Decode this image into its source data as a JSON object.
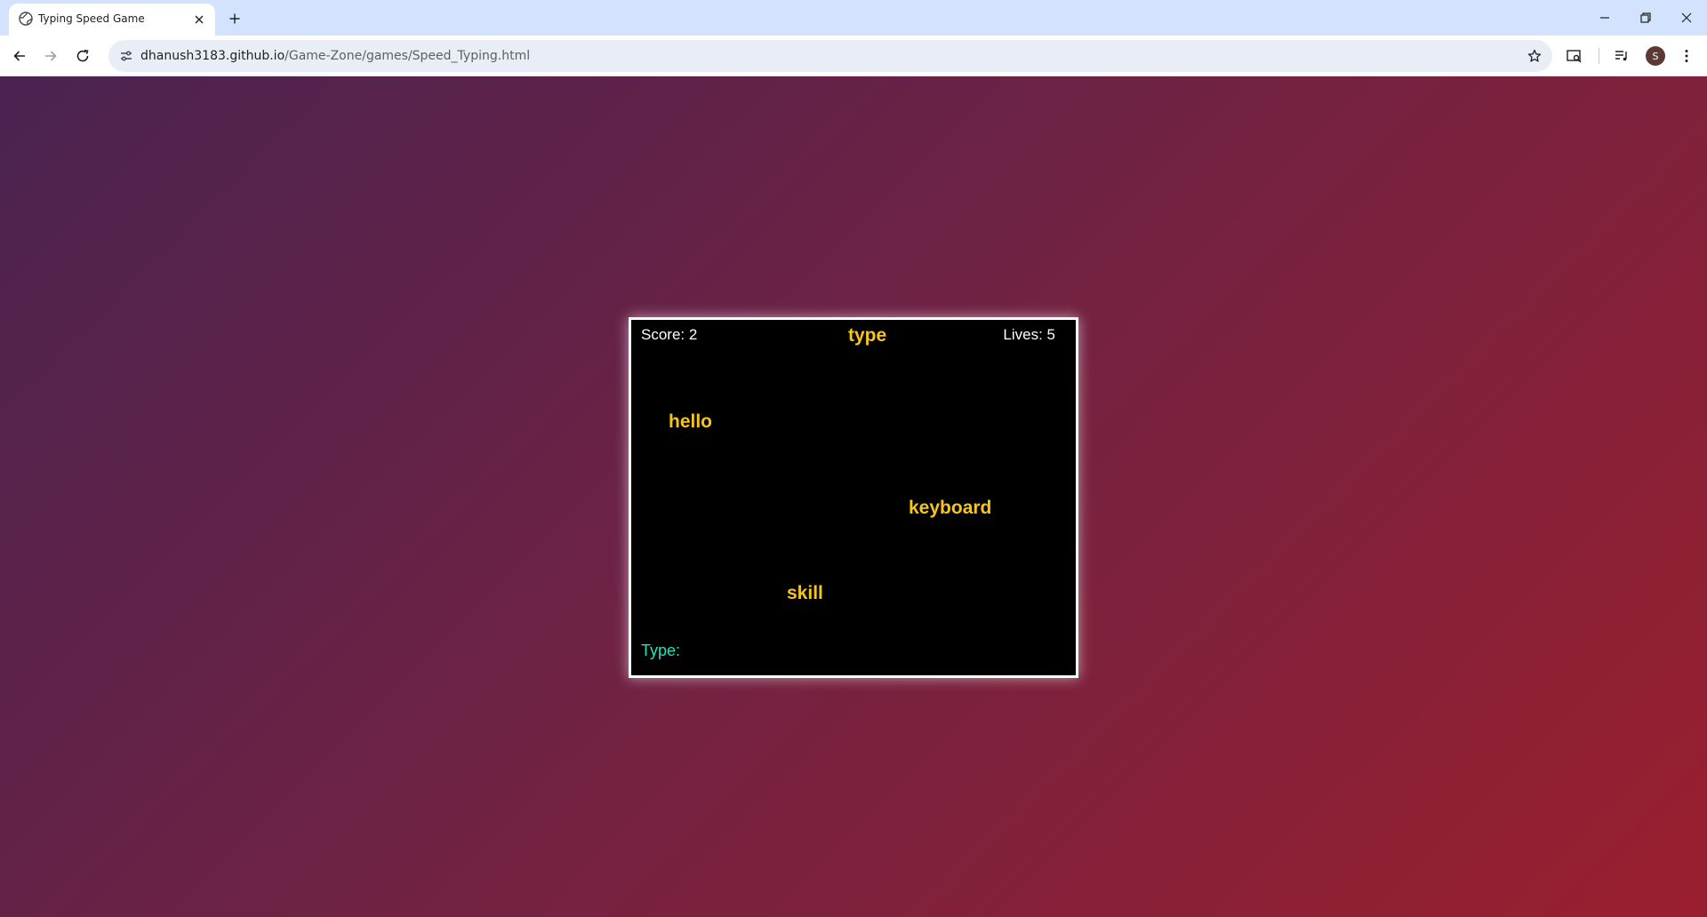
{
  "browser": {
    "tab": {
      "title": "Typing Speed Game",
      "favicon": "globe-icon"
    },
    "omnibox": {
      "host": "dhanush3183.github.io",
      "path": "/Game-Zone/games/Speed_Typing.html"
    },
    "profile_initial": "S"
  },
  "game": {
    "score_text": "Score: 2",
    "lives_text": "Lives: 5",
    "score": 2,
    "lives": 5,
    "falling_words": [
      "type",
      "hello",
      "keyboard",
      "skill"
    ],
    "type_label": "Type:",
    "typed_value": "",
    "colors": {
      "word": "#f5c518",
      "input": "#20e3c2",
      "background": "#000000",
      "border": "#ffffff"
    }
  }
}
